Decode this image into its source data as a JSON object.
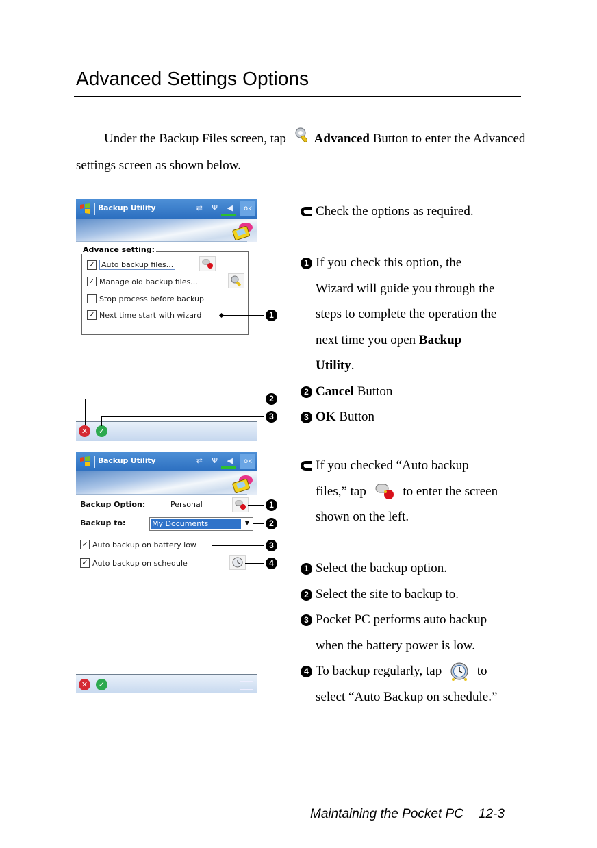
{
  "heading": "Advanced Settings Options",
  "intro": {
    "before": "Under the Backup Files screen, tap",
    "icon": "wrench-magnifier-icon",
    "bold": "Advanced",
    "after": "Button to enter the Advanced settings screen as shown below."
  },
  "screen1": {
    "window_title": "Backup Utility",
    "status_icons": [
      "sync-icon",
      "antenna-icon",
      "speaker-icon"
    ],
    "ok_label": "ok",
    "group_title": "Advance setting:",
    "options": [
      {
        "label": "Auto backup files...",
        "checked": true,
        "button_icon": "auto-backup-icon"
      },
      {
        "label": "Manage old backup files...",
        "checked": true,
        "button_icon": "wrench-icon"
      },
      {
        "label": "Stop process before backup",
        "checked": false
      },
      {
        "label": "Next time start with wizard",
        "checked": true
      }
    ],
    "callouts": [
      "1",
      "2",
      "3"
    ],
    "menu": {
      "cancel_icon": "cancel-icon",
      "ok_icon": "ok-icon"
    }
  },
  "screen2": {
    "window_title": "Backup Utility",
    "ok_label": "ok",
    "backup_option_label": "Backup Option:",
    "backup_option_value": "Personal",
    "backup_to_label": "Backup to:",
    "backup_to_value": "My Documents",
    "options": [
      {
        "label": "Auto backup on battery low",
        "checked": true
      },
      {
        "label": "Auto backup on schedule",
        "checked": true,
        "button_icon": "clock-icon"
      }
    ],
    "callouts": [
      "1",
      "2",
      "3",
      "4"
    ],
    "menu": {
      "cancel_icon": "cancel-icon",
      "ok_icon": "ok-icon",
      "keyboard_icon": "keyboard-icon"
    }
  },
  "section1": {
    "lead": "Check the options as required.",
    "items": [
      {
        "num": "1",
        "text": "If you check this option, the Wizard will guide you through the steps to complete the operation the next time you open ",
        "bold_tail": "Backup Utility",
        "tail": "."
      },
      {
        "num": "2",
        "bold": "Cancel",
        "text": " Button"
      },
      {
        "num": "3",
        "bold": "OK",
        "text": " Button"
      }
    ],
    "line1": "If you check this option, the",
    "line2": "Wizard will guide you through the",
    "line3": "steps to complete the operation the",
    "line4": "next time you open ",
    "line4_bold": "Backup",
    "line5_bold": "Utility",
    "line5": "."
  },
  "section2": {
    "lead_1": "If you checked “Auto backup",
    "lead_2a": "files,” tap",
    "lead_2b": "to enter the screen",
    "lead_3": "shown on the left.",
    "items": [
      {
        "num": "1",
        "text": "Select the backup option."
      },
      {
        "num": "2",
        "text": "Select the site to backup to."
      },
      {
        "num": "3",
        "text": "Pocket PC performs auto backup",
        "cont": "when the battery power is low."
      },
      {
        "num": "4",
        "text": "To backup regularly, tap",
        "after_icon": "to",
        "cont": "select “Auto Backup on schedule.”"
      }
    ]
  },
  "footer": {
    "chapter": "Maintaining the Pocket PC",
    "page": "12-3"
  }
}
